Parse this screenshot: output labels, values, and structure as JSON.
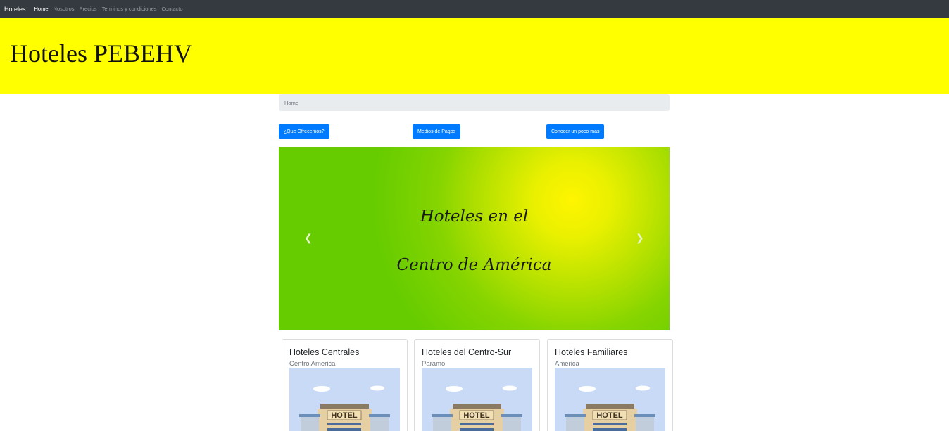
{
  "navbar": {
    "brand": "Hoteles",
    "links": [
      {
        "label": "Home",
        "active": true
      },
      {
        "label": "Nosotros",
        "active": false
      },
      {
        "label": "Precios",
        "active": false
      },
      {
        "label": "Terminos y condiciones",
        "active": false
      },
      {
        "label": "Contacto",
        "active": false
      }
    ]
  },
  "jumbotron": {
    "title": "Hoteles PEBEHV",
    "background": "#ffff00"
  },
  "breadcrumb": {
    "current": "Home"
  },
  "buttons": [
    {
      "label": "¿Que Ofrecemos?"
    },
    {
      "label": "Medios de Pagos"
    },
    {
      "label": "Conocer un poco mas"
    }
  ],
  "carousel": {
    "line1": "Hoteles en el",
    "line2": "Centro de América",
    "prev_icon": "chevron-left-icon",
    "next_icon": "chevron-right-icon",
    "colors": {
      "base": "#66cc00",
      "glow": "#fff500"
    }
  },
  "cards": [
    {
      "title": "Hoteles Centrales",
      "subtitle": "Centro America",
      "image_text": "HOTEL"
    },
    {
      "title": "Hoteles del Centro-Sur",
      "subtitle": "Paramo",
      "image_text": "HOTEL"
    },
    {
      "title": "Hoteles Familiares",
      "subtitle": "America",
      "image_text": "HOTEL"
    }
  ],
  "colors": {
    "navbar": "#343a40",
    "primary": "#007bff",
    "breadcrumb": "#e9ecef"
  }
}
